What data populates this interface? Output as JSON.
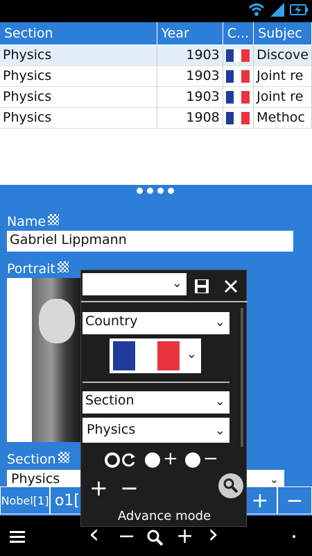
{
  "table": {
    "headers": [
      "Section",
      "Year",
      "C...",
      "Subjec"
    ],
    "rows": [
      {
        "section": "Physics",
        "year": "1903",
        "subject": "Discove"
      },
      {
        "section": "Physics",
        "year": "1903",
        "subject": "Joint re"
      },
      {
        "section": "Physics",
        "year": "1903",
        "subject": "Joint re"
      },
      {
        "section": "Physics",
        "year": "1908",
        "subject": "Methoc"
      }
    ]
  },
  "flag_colors": {
    "blue": "#1f3c9b",
    "white": "#ffffff",
    "red": "#e8343f"
  },
  "accent": "#2c7ed6",
  "detail": {
    "name_label": "Name",
    "name_value": "Gabriel Lippmann",
    "portrait_label": "Portrait",
    "section_label": "Section",
    "section_value": "Physics"
  },
  "strip": {
    "nobel_label": "Nobel[1]",
    "o1_label": "o1[",
    "plus": "+",
    "minus": "−"
  },
  "popup": {
    "top_select_value": "",
    "country_label": "Country",
    "section_label": "Section",
    "section_value": "Physics",
    "advance_mode": "Advance mode",
    "plus": "+",
    "minus": "−"
  },
  "navbar": {
    "prev": "‹",
    "minus": "−",
    "plus": "+",
    "next": "›"
  },
  "icons": [
    "wifi-icon",
    "signal-icon",
    "battery-icon",
    "menu-icon",
    "search-icon",
    "save-icon",
    "close-icon",
    "refresh-icon"
  ]
}
